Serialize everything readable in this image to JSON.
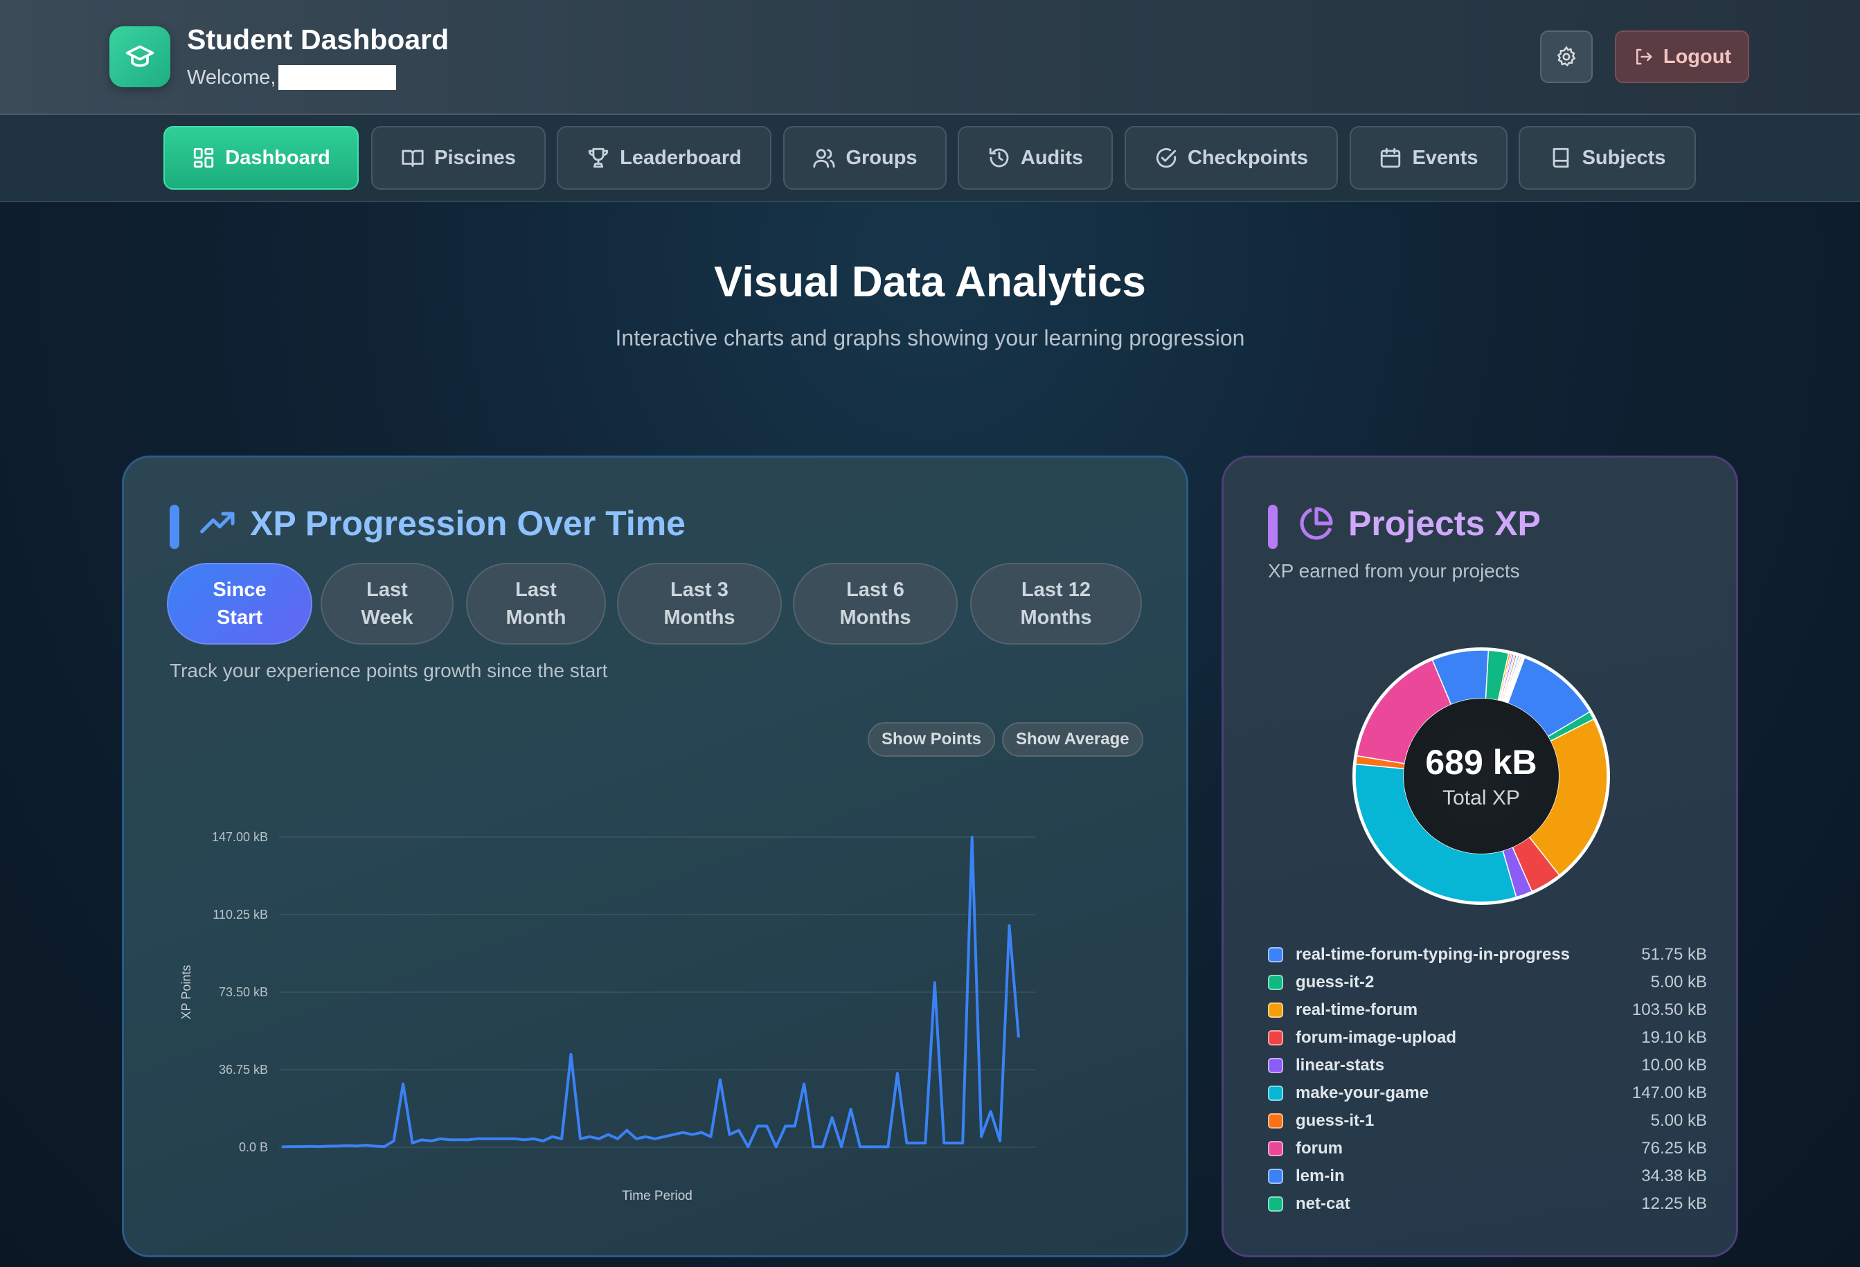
{
  "header": {
    "title": "Student Dashboard",
    "welcome": "Welcome,",
    "logout_label": "Logout"
  },
  "nav": {
    "tabs": [
      {
        "label": "Dashboard",
        "icon": "dashboard-grid-icon",
        "active": true
      },
      {
        "label": "Piscines",
        "icon": "book-open-icon",
        "active": false
      },
      {
        "label": "Leaderboard",
        "icon": "trophy-icon",
        "active": false
      },
      {
        "label": "Groups",
        "icon": "users-icon",
        "active": false
      },
      {
        "label": "Audits",
        "icon": "history-icon",
        "active": false
      },
      {
        "label": "Checkpoints",
        "icon": "check-circle-icon",
        "active": false
      },
      {
        "label": "Events",
        "icon": "calendar-icon",
        "active": false
      },
      {
        "label": "Subjects",
        "icon": "book-icon",
        "active": false
      }
    ]
  },
  "page": {
    "title": "Visual Data Analytics",
    "subtitle": "Interactive charts and graphs showing your learning progression"
  },
  "xp_card": {
    "title": "XP Progression Over Time",
    "ranges": [
      {
        "line1": "Since",
        "line2": "Start",
        "active": true
      },
      {
        "line1": "Last",
        "line2": "Week",
        "active": false
      },
      {
        "line1": "Last",
        "line2": "Month",
        "active": false
      },
      {
        "line1": "Last 3",
        "line2": "Months",
        "active": false
      },
      {
        "line1": "Last 6",
        "line2": "Months",
        "active": false
      },
      {
        "line1": "Last 12",
        "line2": "Months",
        "active": false
      }
    ],
    "description": "Track your experience points growth since the start",
    "show_points_label": "Show Points",
    "show_average_label": "Show Average"
  },
  "projects_card": {
    "title": "Projects XP",
    "subtitle": "XP earned from your projects",
    "total": "689 kB",
    "total_label": "Total XP",
    "items": [
      {
        "name": "real-time-forum-typing-in-progress",
        "value": "51.75 kB",
        "color": "#3b82f6"
      },
      {
        "name": "guess-it-2",
        "value": "5.00 kB",
        "color": "#10b981"
      },
      {
        "name": "real-time-forum",
        "value": "103.50 kB",
        "color": "#f59e0b"
      },
      {
        "name": "forum-image-upload",
        "value": "19.10 kB",
        "color": "#ef4444"
      },
      {
        "name": "linear-stats",
        "value": "10.00 kB",
        "color": "#8b5cf6"
      },
      {
        "name": "make-your-game",
        "value": "147.00 kB",
        "color": "#06b6d4"
      },
      {
        "name": "guess-it-1",
        "value": "5.00 kB",
        "color": "#f97316"
      },
      {
        "name": "forum",
        "value": "76.25 kB",
        "color": "#ec4899"
      },
      {
        "name": "lem-in",
        "value": "34.38 kB",
        "color": "#3b82f6"
      },
      {
        "name": "net-cat",
        "value": "12.25 kB",
        "color": "#10b981"
      }
    ]
  },
  "chart_data": {
    "type": "line",
    "title": "",
    "xlabel": "Time Period",
    "ylabel": "XP Points",
    "y_ticks": [
      "0.0 B",
      "36.75 kB",
      "73.50 kB",
      "110.25 kB",
      "147.00 kB"
    ],
    "ylim": [
      0,
      147
    ],
    "y_unit": "kB",
    "grid": true,
    "series": [
      {
        "color": "#3b82f6",
        "values": [
          0.2,
          0.3,
          0.3,
          0.4,
          0.3,
          0.5,
          0.6,
          0.8,
          0.6,
          1.0,
          0.5,
          0.3,
          3.0,
          30.0,
          2.0,
          3.5,
          3.0,
          4.0,
          3.5,
          3.5,
          3.5,
          4.0,
          4.0,
          4.0,
          4.0,
          4.0,
          3.5,
          4.0,
          3.0,
          5.0,
          4.0,
          44.0,
          4.0,
          5.0,
          4.0,
          6.0,
          4.0,
          8.0,
          4.0,
          5.0,
          4.0,
          5.0,
          6.0,
          7.0,
          6.0,
          7.0,
          5.0,
          32.0,
          6.0,
          8.0,
          0.2,
          10.0,
          10.0,
          0.2,
          10.0,
          10.0,
          30.0,
          0.2,
          0.2,
          14.0,
          0.2,
          18.0,
          0.2,
          0.2,
          0.2,
          0.2,
          35.0,
          2.0,
          2.0,
          2.0,
          78.0,
          2.0,
          2.0,
          2.0,
          147.0,
          5.0,
          17.0,
          3.0,
          105.0,
          52.0
        ]
      }
    ]
  }
}
